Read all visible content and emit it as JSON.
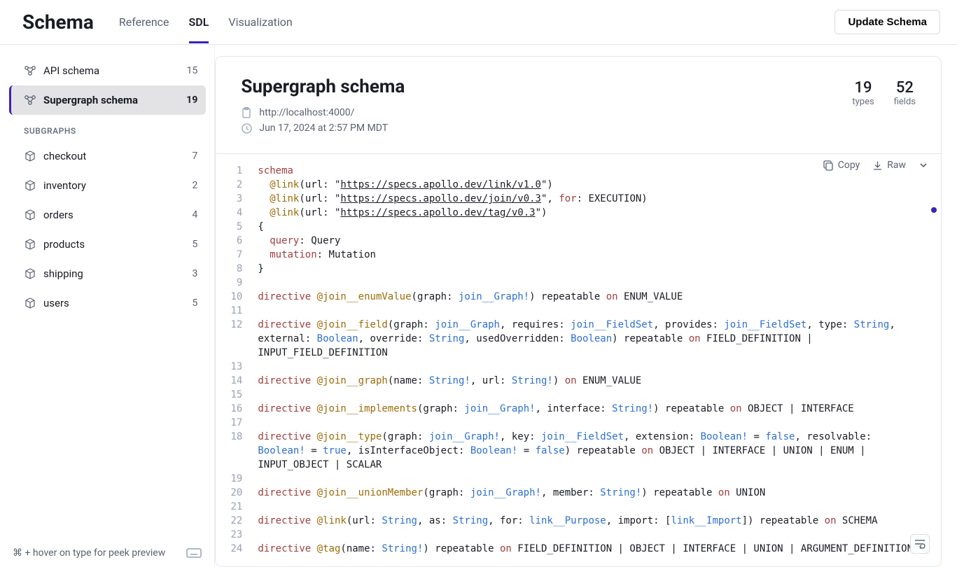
{
  "header": {
    "title": "Schema",
    "tabs": [
      {
        "label": "Reference",
        "active": false
      },
      {
        "label": "SDL",
        "active": true
      },
      {
        "label": "Visualization",
        "active": false
      }
    ],
    "action": "Update Schema"
  },
  "sidebar": {
    "top": [
      {
        "icon": "graph",
        "label": "API schema",
        "count": 15,
        "active": false
      },
      {
        "icon": "graph",
        "label": "Supergraph schema",
        "count": 19,
        "active": true
      }
    ],
    "section_label": "SUBGRAPHS",
    "subgraphs": [
      {
        "icon": "cube",
        "label": "checkout",
        "count": 7
      },
      {
        "icon": "cube",
        "label": "inventory",
        "count": 2
      },
      {
        "icon": "cube",
        "label": "orders",
        "count": 4
      },
      {
        "icon": "cube",
        "label": "products",
        "count": 5
      },
      {
        "icon": "cube",
        "label": "shipping",
        "count": 3
      },
      {
        "icon": "cube",
        "label": "users",
        "count": 5
      }
    ],
    "footer_hint": "⌘ + hover on type for peek preview"
  },
  "main": {
    "title": "Supergraph schema",
    "url": "http://localhost:4000/",
    "timestamp": "Jun 17, 2024 at 2:57 PM MDT",
    "stats": [
      {
        "num": "19",
        "label": "types"
      },
      {
        "num": "52",
        "label": "fields"
      }
    ],
    "toolbar": {
      "copy": "Copy",
      "raw": "Raw"
    }
  },
  "code": [
    {
      "n": 1,
      "tok": [
        [
          "k-dir",
          "schema"
        ]
      ]
    },
    {
      "n": 2,
      "tok": [
        [
          "k-plain",
          "  "
        ],
        [
          "k-at",
          "@link"
        ],
        [
          "k-punc",
          "("
        ],
        [
          "k-plain",
          "url"
        ],
        [
          "k-punc",
          ": "
        ],
        [
          "k-str",
          "\""
        ],
        [
          "k-url",
          "https://specs.apollo.dev/link/v1.0"
        ],
        [
          "k-str",
          "\""
        ],
        [
          "k-punc",
          ")"
        ]
      ]
    },
    {
      "n": 3,
      "tok": [
        [
          "k-plain",
          "  "
        ],
        [
          "k-at",
          "@link"
        ],
        [
          "k-punc",
          "("
        ],
        [
          "k-plain",
          "url"
        ],
        [
          "k-punc",
          ": "
        ],
        [
          "k-str",
          "\""
        ],
        [
          "k-url",
          "https://specs.apollo.dev/join/v0.3"
        ],
        [
          "k-str",
          "\""
        ],
        [
          "k-punc",
          ", "
        ],
        [
          "k-dir",
          "for"
        ],
        [
          "k-punc",
          ": "
        ],
        [
          "k-plain",
          "EXECUTION"
        ],
        [
          "k-punc",
          ")"
        ]
      ]
    },
    {
      "n": 4,
      "tok": [
        [
          "k-plain",
          "  "
        ],
        [
          "k-at",
          "@link"
        ],
        [
          "k-punc",
          "("
        ],
        [
          "k-plain",
          "url"
        ],
        [
          "k-punc",
          ": "
        ],
        [
          "k-str",
          "\""
        ],
        [
          "k-url",
          "https://specs.apollo.dev/tag/v0.3"
        ],
        [
          "k-str",
          "\""
        ],
        [
          "k-punc",
          ")"
        ]
      ]
    },
    {
      "n": 5,
      "tok": [
        [
          "k-punc",
          "{"
        ]
      ]
    },
    {
      "n": 6,
      "tok": [
        [
          "k-plain",
          "  "
        ],
        [
          "k-dir",
          "query"
        ],
        [
          "k-punc",
          ": "
        ],
        [
          "k-plain",
          "Query"
        ]
      ]
    },
    {
      "n": 7,
      "tok": [
        [
          "k-plain",
          "  "
        ],
        [
          "k-dir",
          "mutation"
        ],
        [
          "k-punc",
          ": "
        ],
        [
          "k-plain",
          "Mutation"
        ]
      ]
    },
    {
      "n": 8,
      "tok": [
        [
          "k-punc",
          "}"
        ]
      ]
    },
    {
      "n": 9,
      "tok": []
    },
    {
      "n": 10,
      "tok": [
        [
          "k-dir",
          "directive "
        ],
        [
          "k-at",
          "@join__enumValue"
        ],
        [
          "k-punc",
          "("
        ],
        [
          "k-plain",
          "graph"
        ],
        [
          "k-punc",
          ": "
        ],
        [
          "k-type",
          "join__Graph!"
        ],
        [
          "k-punc",
          ") "
        ],
        [
          "k-plain",
          "repeatable "
        ],
        [
          "k-dir",
          "on"
        ],
        [
          "k-plain",
          " ENUM_VALUE"
        ]
      ]
    },
    {
      "n": 11,
      "tok": []
    },
    {
      "n": 12,
      "tok": [
        [
          "k-dir",
          "directive "
        ],
        [
          "k-at",
          "@join__field"
        ],
        [
          "k-punc",
          "("
        ],
        [
          "k-plain",
          "graph"
        ],
        [
          "k-punc",
          ": "
        ],
        [
          "k-type",
          "join__Graph"
        ],
        [
          "k-punc",
          ", "
        ],
        [
          "k-plain",
          "requires"
        ],
        [
          "k-punc",
          ": "
        ],
        [
          "k-type",
          "join__FieldSet"
        ],
        [
          "k-punc",
          ", "
        ],
        [
          "k-plain",
          "provides"
        ],
        [
          "k-punc",
          ": "
        ],
        [
          "k-type",
          "join__FieldSet"
        ],
        [
          "k-punc",
          ", "
        ],
        [
          "k-plain",
          "type"
        ],
        [
          "k-punc",
          ": "
        ],
        [
          "k-type",
          "String"
        ],
        [
          "k-punc",
          ", "
        ]
      ]
    },
    {
      "n": "",
      "tok": [
        [
          "k-plain",
          "external"
        ],
        [
          "k-punc",
          ": "
        ],
        [
          "k-type",
          "Boolean"
        ],
        [
          "k-punc",
          ", "
        ],
        [
          "k-plain",
          "override"
        ],
        [
          "k-punc",
          ": "
        ],
        [
          "k-type",
          "String"
        ],
        [
          "k-punc",
          ", "
        ],
        [
          "k-plain",
          "usedOverridden"
        ],
        [
          "k-punc",
          ": "
        ],
        [
          "k-type",
          "Boolean"
        ],
        [
          "k-punc",
          ") "
        ],
        [
          "k-plain",
          "repeatable "
        ],
        [
          "k-dir",
          "on"
        ],
        [
          "k-plain",
          " FIELD_DEFINITION | "
        ]
      ]
    },
    {
      "n": "",
      "tok": [
        [
          "k-plain",
          "INPUT_FIELD_DEFINITION"
        ]
      ]
    },
    {
      "n": 13,
      "tok": []
    },
    {
      "n": 14,
      "tok": [
        [
          "k-dir",
          "directive "
        ],
        [
          "k-at",
          "@join__graph"
        ],
        [
          "k-punc",
          "("
        ],
        [
          "k-plain",
          "name"
        ],
        [
          "k-punc",
          ": "
        ],
        [
          "k-type",
          "String!"
        ],
        [
          "k-punc",
          ", "
        ],
        [
          "k-plain",
          "url"
        ],
        [
          "k-punc",
          ": "
        ],
        [
          "k-type",
          "String!"
        ],
        [
          "k-punc",
          ") "
        ],
        [
          "k-dir",
          "on"
        ],
        [
          "k-plain",
          " ENUM_VALUE"
        ]
      ]
    },
    {
      "n": 15,
      "tok": []
    },
    {
      "n": 16,
      "tok": [
        [
          "k-dir",
          "directive "
        ],
        [
          "k-at",
          "@join__implements"
        ],
        [
          "k-punc",
          "("
        ],
        [
          "k-plain",
          "graph"
        ],
        [
          "k-punc",
          ": "
        ],
        [
          "k-type",
          "join__Graph!"
        ],
        [
          "k-punc",
          ", "
        ],
        [
          "k-plain",
          "interface"
        ],
        [
          "k-punc",
          ": "
        ],
        [
          "k-type",
          "String!"
        ],
        [
          "k-punc",
          ") "
        ],
        [
          "k-plain",
          "repeatable "
        ],
        [
          "k-dir",
          "on"
        ],
        [
          "k-plain",
          " OBJECT | INTERFACE"
        ]
      ]
    },
    {
      "n": 17,
      "tok": []
    },
    {
      "n": 18,
      "tok": [
        [
          "k-dir",
          "directive "
        ],
        [
          "k-at",
          "@join__type"
        ],
        [
          "k-punc",
          "("
        ],
        [
          "k-plain",
          "graph"
        ],
        [
          "k-punc",
          ": "
        ],
        [
          "k-type",
          "join__Graph!"
        ],
        [
          "k-punc",
          ", "
        ],
        [
          "k-plain",
          "key"
        ],
        [
          "k-punc",
          ": "
        ],
        [
          "k-type",
          "join__FieldSet"
        ],
        [
          "k-punc",
          ", "
        ],
        [
          "k-plain",
          "extension"
        ],
        [
          "k-punc",
          ": "
        ],
        [
          "k-type",
          "Boolean!"
        ],
        [
          "k-punc",
          " = "
        ],
        [
          "k-bool",
          "false"
        ],
        [
          "k-punc",
          ", "
        ],
        [
          "k-plain",
          "resolvable"
        ],
        [
          "k-punc",
          ": "
        ]
      ]
    },
    {
      "n": "",
      "tok": [
        [
          "k-type",
          "Boolean!"
        ],
        [
          "k-punc",
          " = "
        ],
        [
          "k-bool",
          "true"
        ],
        [
          "k-punc",
          ", "
        ],
        [
          "k-plain",
          "isInterfaceObject"
        ],
        [
          "k-punc",
          ": "
        ],
        [
          "k-type",
          "Boolean!"
        ],
        [
          "k-punc",
          " = "
        ],
        [
          "k-bool",
          "false"
        ],
        [
          "k-punc",
          ") "
        ],
        [
          "k-plain",
          "repeatable "
        ],
        [
          "k-dir",
          "on"
        ],
        [
          "k-plain",
          " OBJECT | INTERFACE | UNION | ENUM | "
        ]
      ]
    },
    {
      "n": "",
      "tok": [
        [
          "k-plain",
          "INPUT_OBJECT | SCALAR"
        ]
      ]
    },
    {
      "n": 19,
      "tok": []
    },
    {
      "n": 20,
      "tok": [
        [
          "k-dir",
          "directive "
        ],
        [
          "k-at",
          "@join__unionMember"
        ],
        [
          "k-punc",
          "("
        ],
        [
          "k-plain",
          "graph"
        ],
        [
          "k-punc",
          ": "
        ],
        [
          "k-type",
          "join__Graph!"
        ],
        [
          "k-punc",
          ", "
        ],
        [
          "k-plain",
          "member"
        ],
        [
          "k-punc",
          ": "
        ],
        [
          "k-type",
          "String!"
        ],
        [
          "k-punc",
          ") "
        ],
        [
          "k-plain",
          "repeatable "
        ],
        [
          "k-dir",
          "on"
        ],
        [
          "k-plain",
          " UNION"
        ]
      ]
    },
    {
      "n": 21,
      "tok": []
    },
    {
      "n": 22,
      "tok": [
        [
          "k-dir",
          "directive "
        ],
        [
          "k-at",
          "@link"
        ],
        [
          "k-punc",
          "("
        ],
        [
          "k-plain",
          "url"
        ],
        [
          "k-punc",
          ": "
        ],
        [
          "k-type",
          "String"
        ],
        [
          "k-punc",
          ", "
        ],
        [
          "k-plain",
          "as"
        ],
        [
          "k-punc",
          ": "
        ],
        [
          "k-type",
          "String"
        ],
        [
          "k-punc",
          ", "
        ],
        [
          "k-plain",
          "for"
        ],
        [
          "k-punc",
          ": "
        ],
        [
          "k-type",
          "link__Purpose"
        ],
        [
          "k-punc",
          ", "
        ],
        [
          "k-plain",
          "import"
        ],
        [
          "k-punc",
          ": ["
        ],
        [
          "k-type",
          "link__Import"
        ],
        [
          "k-punc",
          "]) "
        ],
        [
          "k-plain",
          "repeatable "
        ],
        [
          "k-dir",
          "on"
        ],
        [
          "k-plain",
          " SCHEMA"
        ]
      ]
    },
    {
      "n": 23,
      "tok": []
    },
    {
      "n": 24,
      "tok": [
        [
          "k-dir",
          "directive "
        ],
        [
          "k-at",
          "@tag"
        ],
        [
          "k-punc",
          "("
        ],
        [
          "k-plain",
          "name"
        ],
        [
          "k-punc",
          ": "
        ],
        [
          "k-type",
          "String!"
        ],
        [
          "k-punc",
          ") "
        ],
        [
          "k-plain",
          "repeatable "
        ],
        [
          "k-dir",
          "on"
        ],
        [
          "k-plain",
          " FIELD_DEFINITION | OBJECT | INTERFACE | UNION | ARGUMENT_DEFINITION"
        ]
      ]
    }
  ]
}
